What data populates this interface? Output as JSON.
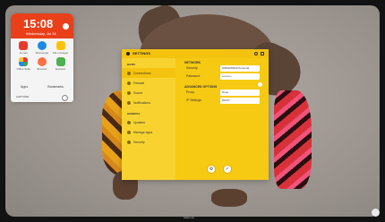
{
  "colors": {
    "accent": "#f6c912",
    "clock_bg": "#e9401a"
  },
  "widget": {
    "time": "15:08",
    "date": "Wednesday, Jul 24",
    "apps": [
      {
        "label": "E-mail",
        "color": "#e8392b"
      },
      {
        "label": "Messenger",
        "color": "#1e88e5"
      },
      {
        "label": "File manager",
        "color": "#ffc107"
      },
      {
        "label": "Office Suite",
        "color": "#e53935"
      },
      {
        "label": "Browser",
        "color": "#ff7043"
      },
      {
        "label": "Explorer",
        "color": "#4caf50"
      }
    ],
    "footer_left": "Apps",
    "footer_right": "Bookmarks",
    "caption": "CAPTURE"
  },
  "settings": {
    "title": "SETTINGS",
    "sidebar_section_1": "BASIC",
    "sidebar_section_2": "GENERAL",
    "sidebar_items": [
      {
        "label": "Connections",
        "active": true
      },
      {
        "label": "Firewall",
        "active": false
      },
      {
        "label": "Sound",
        "active": false
      },
      {
        "label": "Notifications",
        "active": false
      },
      {
        "label": "Updates",
        "active": false
      },
      {
        "label": "Manage apps",
        "active": false
      },
      {
        "label": "Security",
        "active": false
      }
    ],
    "main_section_1": "NETWORK",
    "main_section_2": "ADVANCED OPTIONS",
    "rows": [
      {
        "label": "Security",
        "value": "WPA2/WPA3 Personal"
      },
      {
        "label": "Password",
        "value": "••••••••••"
      }
    ],
    "rows2": [
      {
        "label": "Proxy",
        "value": "None"
      },
      {
        "label": "IP Settings",
        "value": "DHCP"
      }
    ]
  },
  "bottom_hint": "swipe up"
}
